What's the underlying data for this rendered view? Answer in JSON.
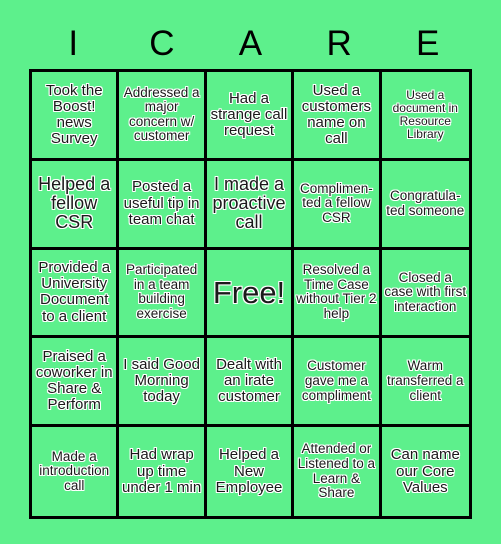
{
  "card": {
    "background_color": "#5df08c",
    "border_color": "#000000",
    "text_color": "#1a1a1a",
    "text_outline_color": "#ffffff",
    "header_letters": [
      "I",
      "C",
      "A",
      "R",
      "E"
    ],
    "rows": 5,
    "columns": 5,
    "cells": [
      {
        "text": "Took the Boost! news Survey",
        "size": "fs-m"
      },
      {
        "text": "Addressed a major concern w/ customer",
        "size": "fs-s"
      },
      {
        "text": "Had a strange call request",
        "size": "fs-m"
      },
      {
        "text": "Used a customers name on call",
        "size": "fs-m"
      },
      {
        "text": "Used a document in Resource Library",
        "size": "fs-xs"
      },
      {
        "text": "Helped a fellow CSR",
        "size": "fs-l"
      },
      {
        "text": "Posted a useful tip in team chat",
        "size": "fs-m"
      },
      {
        "text": "I made a proactive call",
        "size": "fs-l"
      },
      {
        "text": "Complimen-ted a fellow CSR",
        "size": "fs-s"
      },
      {
        "text": "Congratula-ted someone",
        "size": "fs-s"
      },
      {
        "text": "Provided a University Document to a client",
        "size": "fs-m"
      },
      {
        "text": "Participated in a team building exercise",
        "size": "fs-s"
      },
      {
        "text": "Free!",
        "size": "fs-free"
      },
      {
        "text": "Resolved a Time Case without Tier 2 help",
        "size": "fs-s"
      },
      {
        "text": "Closed a case with first interaction",
        "size": "fs-s"
      },
      {
        "text": "Praised a coworker in Share & Perform",
        "size": "fs-m"
      },
      {
        "text": "I said Good Morning today",
        "size": "fs-m"
      },
      {
        "text": "Dealt with an irate customer",
        "size": "fs-m"
      },
      {
        "text": "Customer gave me a compliment",
        "size": "fs-s"
      },
      {
        "text": "Warm transferred a client",
        "size": "fs-s"
      },
      {
        "text": "Made a introduction call",
        "size": "fs-s"
      },
      {
        "text": "Had wrap up time under 1 min",
        "size": "fs-m"
      },
      {
        "text": "Helped a New Employee",
        "size": "fs-m"
      },
      {
        "text": "Attended or Listened to a Learn & Share",
        "size": "fs-s"
      },
      {
        "text": "Can name our Core Values",
        "size": "fs-m"
      }
    ]
  }
}
